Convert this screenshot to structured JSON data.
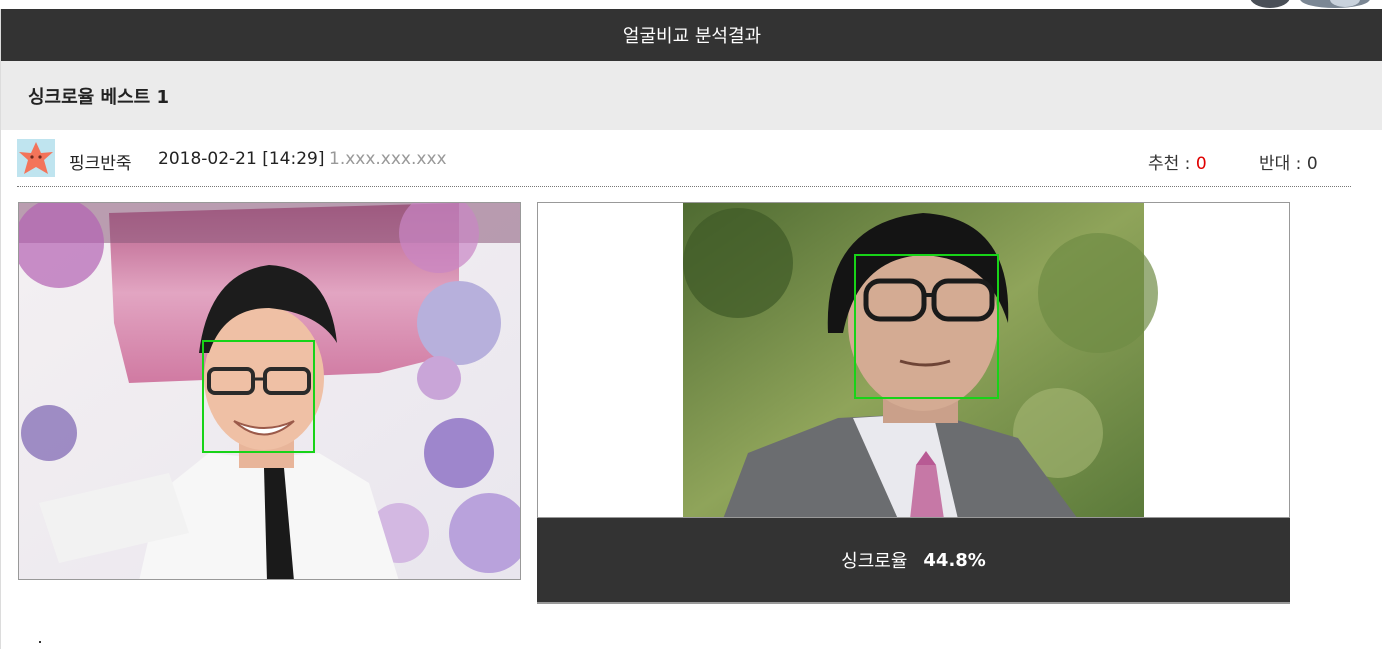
{
  "window": {
    "title": "얼굴비교 분석결과"
  },
  "section": {
    "heading": "싱크로율 베스트 1"
  },
  "post": {
    "author": "핑크반죽",
    "datetime": "2018-02-21 [14:29]",
    "ip": "1.xxx.xxx.xxx",
    "recommend_label": "추천 :",
    "recommend_count": "0",
    "oppose_label": "반대 :",
    "oppose_count": "0"
  },
  "result": {
    "label": "싱크로율",
    "value": "44.8%"
  },
  "colors": {
    "header_bg": "#333333",
    "section_bg": "#ebebeb",
    "face_box": "#18d318",
    "recommend_number": "#e00000",
    "ip_text": "#999999"
  },
  "icons": {
    "avatar": "pink-starfish-avatar-icon"
  }
}
